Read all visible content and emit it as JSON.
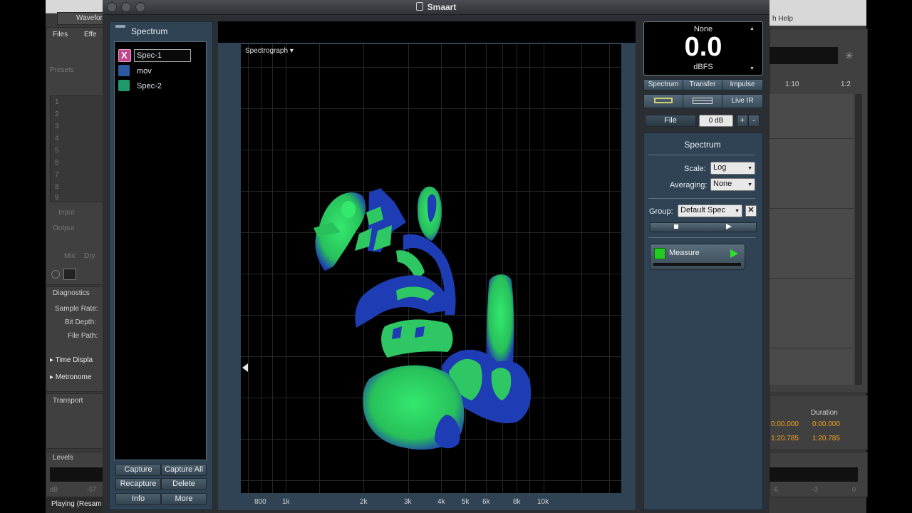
{
  "background_app": {
    "left": {
      "top_tab": "Wavefor",
      "tabs": [
        "Files",
        "Effe"
      ],
      "presets_label": "Presets",
      "slot_numbers": [
        "1",
        "2",
        "3",
        "4",
        "5",
        "6",
        "7",
        "8",
        "9"
      ],
      "input_label": "Input",
      "output_label": "Output",
      "mix_label": "Mix",
      "dry_label": "Dry",
      "diagnostics_title": "Diagnostics",
      "sample_rate_label": "Sample Rate:",
      "bit_depth_label": "Bit Depth:",
      "file_path_label": "File Path:",
      "time_display_label": "Time Displa",
      "metronome_label": "Metronome",
      "transport_title": "Transport",
      "levels_title": "Levels",
      "levels_scale": [
        "dB",
        "-57"
      ],
      "status_text": "Playing (Resam"
    },
    "right": {
      "help_label": "h Help",
      "ruler": [
        "1:10",
        "1:2"
      ],
      "duration_header": "Duration",
      "col_left_values": [
        "0:00.000",
        "1:20.785"
      ],
      "col_right_values": [
        "0:00.000",
        "1:20.785"
      ],
      "levels_scale": [
        "-6",
        "-3",
        "0"
      ]
    }
  },
  "window": {
    "title": "Smaart"
  },
  "spectrum_panel": {
    "header": "Spectrum",
    "items": [
      {
        "label": "Spec-1",
        "color": "#c0458a",
        "selected": true,
        "icon": "X"
      },
      {
        "label": "mov",
        "color": "#2c5aa0",
        "selected": false
      },
      {
        "label": "Spec-2",
        "color": "#1f9a6a",
        "selected": false
      }
    ],
    "buttons": {
      "capture": "Capture",
      "capture_all": "Capture All",
      "recapture": "Recapture",
      "delete": "Delete",
      "info": "Info",
      "more": "More"
    }
  },
  "graph": {
    "mode_label": "Spectrograph ▾",
    "x_ticks": [
      "800",
      "1k",
      "2k",
      "3k",
      "4k",
      "5k",
      "6k",
      "8k",
      "10k"
    ]
  },
  "meter": {
    "source": "None",
    "value": "0.0",
    "unit": "dBFS"
  },
  "mode_tabs": [
    "Spectrum",
    "Transfer",
    "Impulse"
  ],
  "live_ir_label": "Live IR",
  "file_button": "File",
  "gain_value": "0 dB",
  "spectrum_settings": {
    "title": "Spectrum",
    "scale_label": "Scale:",
    "scale_value": "Log",
    "averaging_label": "Averaging:",
    "averaging_value": "None",
    "group_label": "Group:",
    "group_value": "Default Spec"
  },
  "measure": {
    "label": "Measure",
    "indicator_color": "#22cc22"
  },
  "colors": {
    "panel": "#2f4354",
    "spectro_green": "#2de06a",
    "spectro_blue": "#1e3cb4"
  }
}
